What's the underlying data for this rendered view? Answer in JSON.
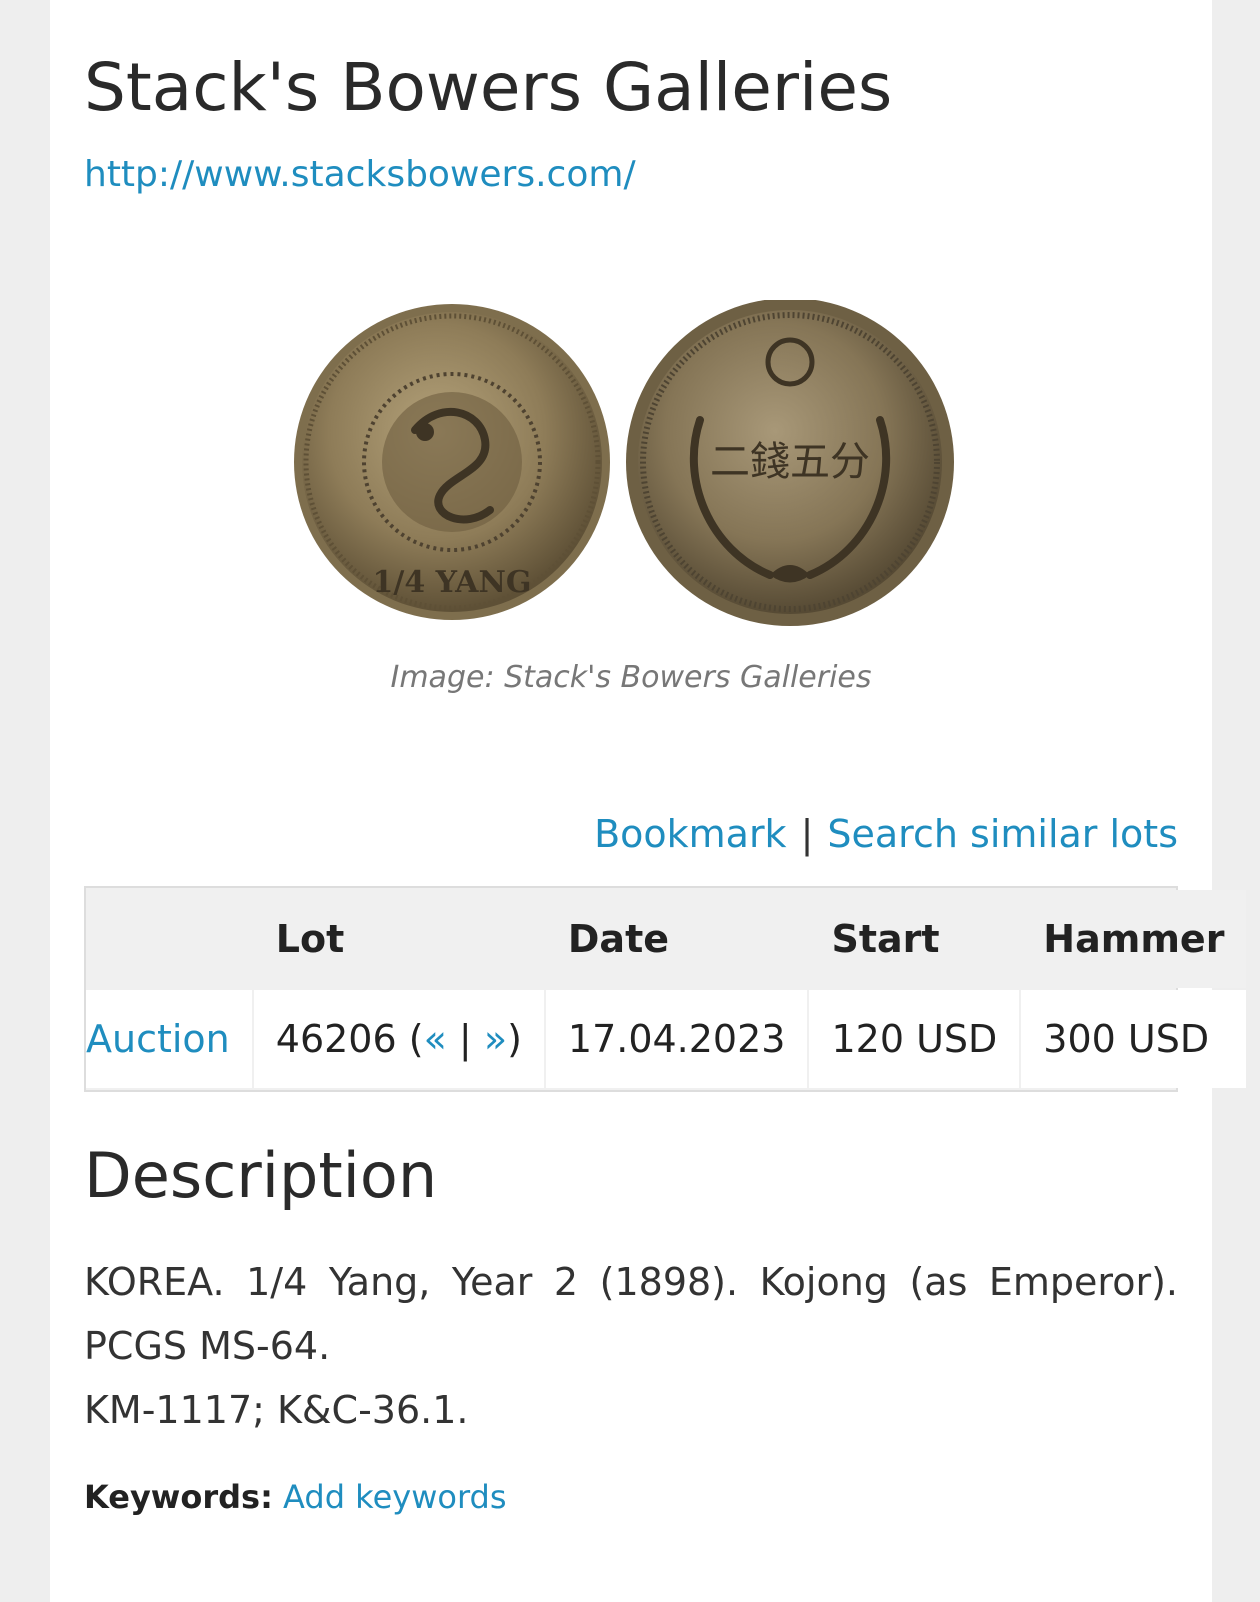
{
  "header": {
    "title": "Stack's Bowers Galleries",
    "url": "http://www.stacksbowers.com/"
  },
  "image": {
    "caption": "Image: Stack's Bowers Galleries",
    "obverse_text": "1/4 YANG",
    "reverse_text": "二錢五分"
  },
  "actions": {
    "bookmark": "Bookmark",
    "separator": "|",
    "search_similar": "Search similar lots"
  },
  "lot_table": {
    "headers": [
      "",
      "Lot",
      "Date",
      "Start",
      "Hammer"
    ],
    "row": {
      "auction": "Auction",
      "lot": "46206",
      "prev": "«",
      "nav_sep": "|",
      "next": "»",
      "date": "17.04.2023",
      "start": "120 USD",
      "hammer": "300 USD"
    }
  },
  "description": {
    "heading": "Description",
    "line1": "KOREA. 1/4 Yang, Year 2 (1898). Kojong (as Emperor). PCGS MS-64.",
    "line2": "KM-1117; K&C-36.1."
  },
  "keywords": {
    "label": "Keywords:",
    "link": "Add keywords"
  },
  "colors": {
    "link": "#1f8dbf",
    "background": "#eeeeee",
    "card": "#ffffff"
  }
}
